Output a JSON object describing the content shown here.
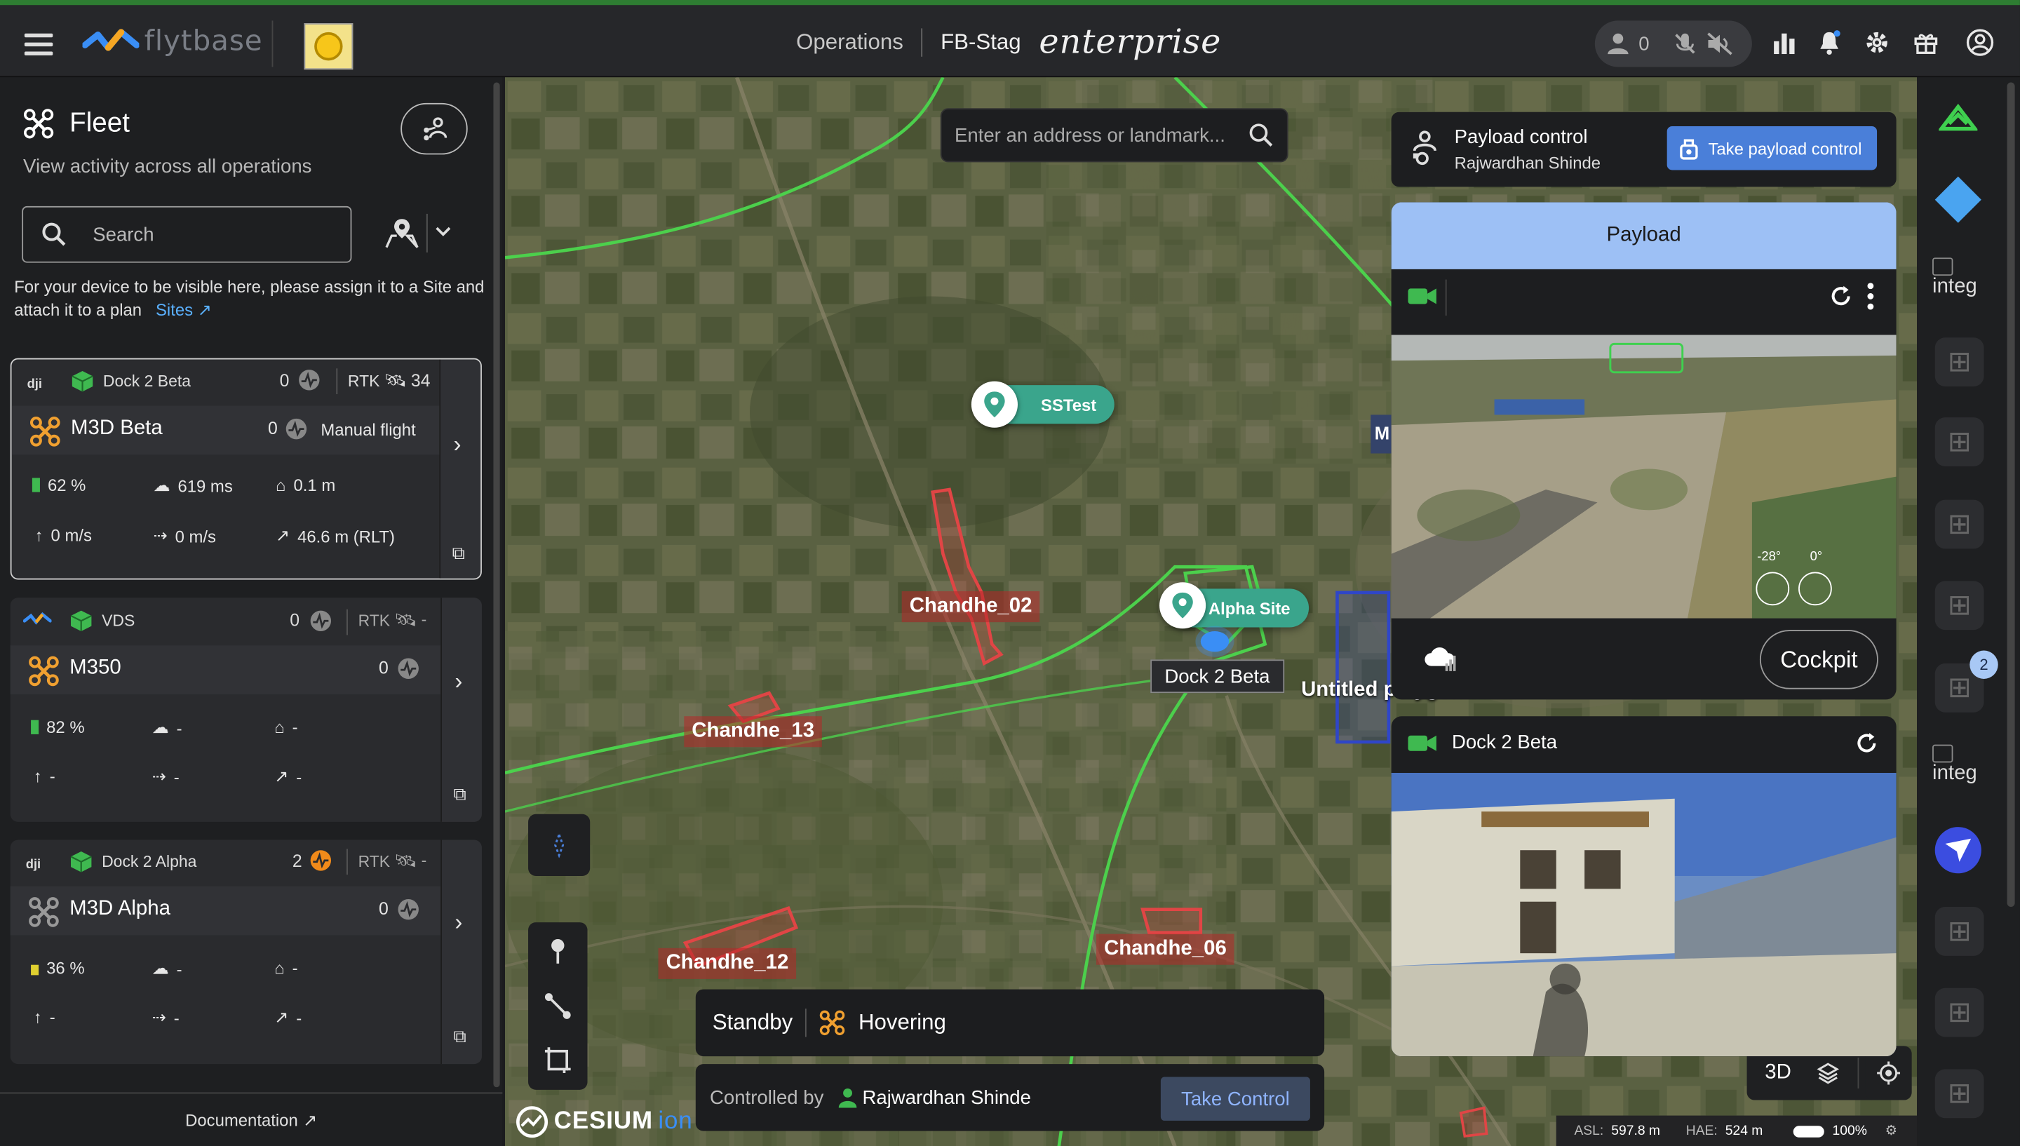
{
  "app": {
    "logo_text": "flytbase",
    "nav_operations": "Operations",
    "nav_org": "FB-Stag",
    "nav_plan": "enterprise",
    "user_count": "0"
  },
  "fleet": {
    "title": "Fleet",
    "subtitle": "View activity across all operations",
    "search_placeholder": "Search",
    "info_text": "For your device to be visible here, please assign it to a Site and attach it to a plan",
    "sites_link": "Sites",
    "cards": [
      {
        "dock": "Dock 2 Beta",
        "dock_count": "0",
        "rtk_label": "RTK",
        "rtk_value": "34",
        "drone": "M3D Beta",
        "drone_count": "0",
        "mode": "Manual flight",
        "battery": "62 %",
        "latency": "619 ms",
        "home_dist": "0.1 m",
        "v_speed": "0 m/s",
        "h_speed": "0 m/s",
        "altitude": "46.6 m (RLT)"
      },
      {
        "dock": "VDS",
        "dock_count": "0",
        "rtk_label": "RTK",
        "rtk_value": "-",
        "drone": "M350",
        "drone_count": "0",
        "battery": "82 %",
        "latency": "-",
        "home_dist": "-",
        "v_speed": "-",
        "h_speed": "-",
        "altitude": "-"
      },
      {
        "dock": "Dock 2 Alpha",
        "dock_count": "2",
        "rtk_label": "RTK",
        "rtk_value": "-",
        "drone": "M3D Alpha",
        "drone_count": "0",
        "battery": "36 %",
        "latency": "-",
        "home_dist": "-",
        "v_speed": "-",
        "h_speed": "-",
        "altitude": "-"
      }
    ],
    "documentation": "Documentation"
  },
  "map": {
    "address_placeholder": "Enter an address or landmark...",
    "labels": {
      "ss_test": "SSTest",
      "alpha_site": "Alpha Site",
      "dock_tag": "Dock 2 Beta",
      "chandhe_02": "Chandhe_02",
      "chandhe_13": "Chandhe_13",
      "chandhe_12": "Chandhe_12",
      "chandhe_06": "Chandhe_06",
      "untitled": "Untitled polygon unit...",
      "edge_m": "M"
    },
    "status": {
      "state": "Standby",
      "flight_state": "Hovering",
      "controlled_by_label": "Controlled by",
      "controller": "Rajwardhan Shinde",
      "take_control": "Take Control"
    },
    "cesium": "CESIUM",
    "cesium_suffix": "ion",
    "view_mode": "3D",
    "asl_label": "ASL:",
    "asl_value": "597.8 m",
    "hae_label": "HAE:",
    "hae_value": "524 m",
    "zoom": "100%"
  },
  "payload": {
    "control_title": "Payload control",
    "control_user": "Rajwardhan Shinde",
    "take_payload": "Take payload control",
    "panel_title": "Payload",
    "gimbal_pitch": "-28°",
    "gimbal_yaw": "0°",
    "cockpit": "Cockpit",
    "dock_feed_title": "Dock 2 Beta"
  },
  "rightbar": {
    "integ_label_1": "integ",
    "integ_label_2": "integ",
    "badge": "2"
  },
  "colors": {
    "accent_blue": "#4a7fd9",
    "payload_header": "#9dc0f5",
    "alpha_pin": "#3aa58c",
    "boundary_green": "#4cd04c",
    "polygon_red": "#e04545"
  }
}
